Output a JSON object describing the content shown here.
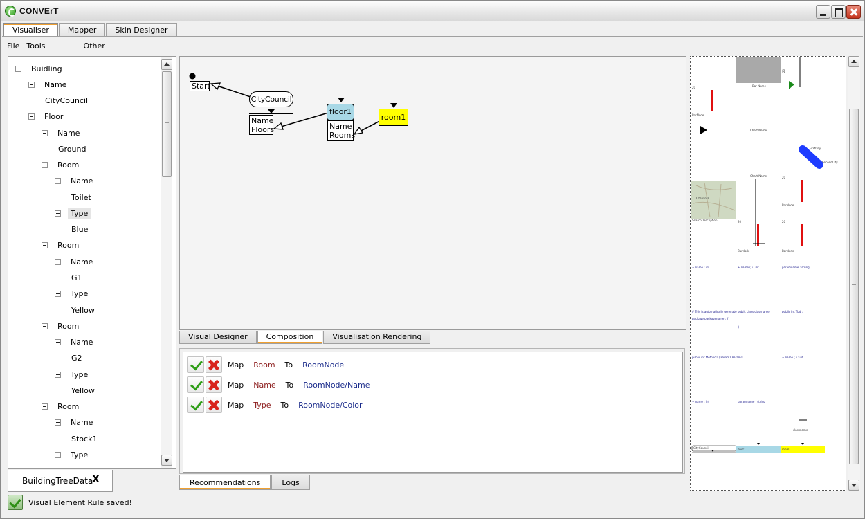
{
  "window": {
    "title": "CONVErT"
  },
  "top_tabs": [
    "Visualiser",
    "Mapper",
    "Skin Designer"
  ],
  "menu": [
    "File",
    "Tools",
    "Other"
  ],
  "tree": [
    {
      "label": "Buidling",
      "level": 0,
      "toggle": true
    },
    {
      "label": "Name",
      "level": 1,
      "toggle": true
    },
    {
      "label": "CityCouncil",
      "level": 2,
      "toggle": false
    },
    {
      "label": "Floor",
      "level": 1,
      "toggle": true
    },
    {
      "label": "Name",
      "level": 2,
      "toggle": true
    },
    {
      "label": "Ground",
      "level": 3,
      "toggle": false
    },
    {
      "label": "Room",
      "level": 2,
      "toggle": true
    },
    {
      "label": "Name",
      "level": 3,
      "toggle": true
    },
    {
      "label": "Toilet",
      "level": 4,
      "toggle": false
    },
    {
      "label": "Type",
      "level": 3,
      "toggle": true,
      "selected": true
    },
    {
      "label": "Blue",
      "level": 4,
      "toggle": false
    },
    {
      "label": "Room",
      "level": 2,
      "toggle": true
    },
    {
      "label": "Name",
      "level": 3,
      "toggle": true
    },
    {
      "label": "G1",
      "level": 4,
      "toggle": false
    },
    {
      "label": "Type",
      "level": 3,
      "toggle": true
    },
    {
      "label": "Yellow",
      "level": 4,
      "toggle": false
    },
    {
      "label": "Room",
      "level": 2,
      "toggle": true
    },
    {
      "label": "Name",
      "level": 3,
      "toggle": true
    },
    {
      "label": "G2",
      "level": 4,
      "toggle": false
    },
    {
      "label": "Type",
      "level": 3,
      "toggle": true
    },
    {
      "label": "Yellow",
      "level": 4,
      "toggle": false
    },
    {
      "label": "Room",
      "level": 2,
      "toggle": true
    },
    {
      "label": "Name",
      "level": 3,
      "toggle": true
    },
    {
      "label": "Stock1",
      "level": 4,
      "toggle": false
    },
    {
      "label": "Type",
      "level": 3,
      "toggle": true
    }
  ],
  "doc_tab": {
    "label": "BuildingTreeData",
    "close": "X"
  },
  "status": {
    "text": "Visual Element Rule saved!"
  },
  "canvas": {
    "start_label": "Start",
    "city_node": {
      "label": "CityCouncil",
      "fields": [
        "Name",
        "Floors"
      ]
    },
    "floor_node": {
      "label": "floor1",
      "fields": [
        "Name",
        "Rooms"
      ],
      "color": "#a8d8e6"
    },
    "room_node": {
      "label": "room1",
      "color": "#ffff00"
    }
  },
  "middle_tabs": [
    "Visual Designer",
    "Composition",
    "Visualisation Rendering"
  ],
  "rules": [
    {
      "map": "Map",
      "source": "Room",
      "to": "To",
      "target": "RoomNode"
    },
    {
      "map": "Map",
      "source": "Name",
      "to": "To",
      "target": "RoomNode/Name"
    },
    {
      "map": "Map",
      "source": "Type",
      "to": "To",
      "target": "RoomNode/Color"
    }
  ],
  "bottom_tabs": [
    "Recommendations",
    "Logs"
  ],
  "preview": {
    "labels": {
      "bar_name": "Bar Name",
      "chart_name_1": "Chart Name",
      "chart_name_2": "Chart Name",
      "bar_node_1": "BarNode",
      "bar_node_2": "BarNode",
      "bar_node_3": "BarNode",
      "bar_node_4": "BarNode",
      "num_20_1": "20",
      "num_20_2": "20",
      "num_20_3": "20",
      "num_20_4": "20",
      "num_20_5": "20",
      "first_city": "FirstCity",
      "second_city": "SecondCity",
      "search_desc": "SearchDescription",
      "map_city": "Lithuania",
      "class_name": "classname",
      "flt_city": "CityCouncil",
      "flt_floor": "floor1",
      "flt_room": "room1"
    },
    "code_lines": [
      "+ name : int",
      "+ name ( ) : int",
      "paramname : string",
      "// This is automatically generate  public  class  classname",
      "package  packagename  ;          {",
      "public  int  Tbd  ;",
      "}",
      "public  int  Method1 ( Param1  Param1",
      "+ name ( ) : int",
      "+ name : int",
      "paramname : string"
    ]
  }
}
